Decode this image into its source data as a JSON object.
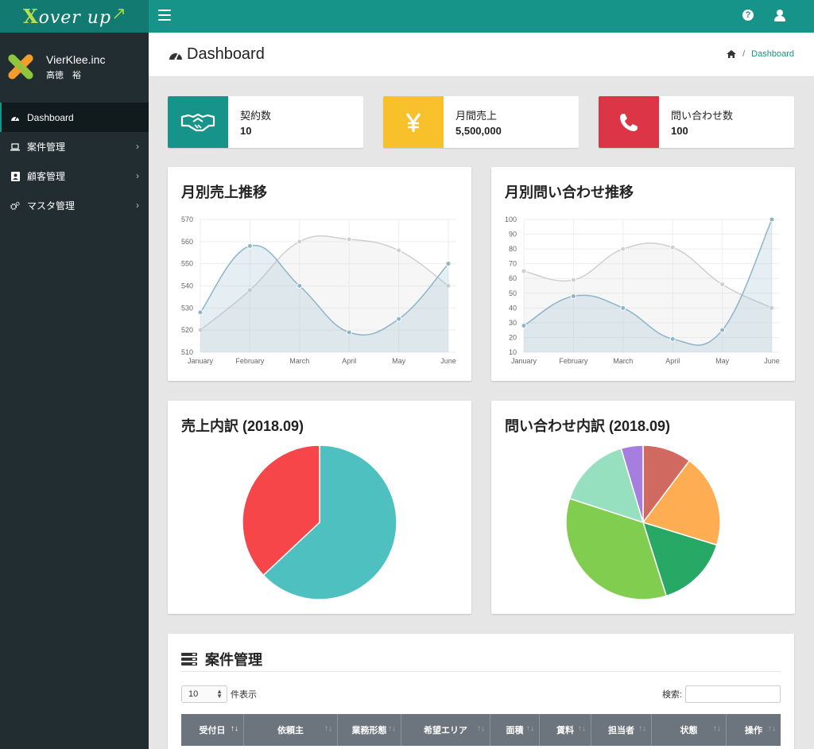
{
  "app": {
    "logo": "over up",
    "logo_x": "X"
  },
  "sidebar": {
    "company": "VierKlee.inc",
    "user": "高徳　裕",
    "items": [
      {
        "label": "Dashboard",
        "icon": "dashboard-icon",
        "active": true
      },
      {
        "label": "案件管理",
        "icon": "laptop-icon"
      },
      {
        "label": "顧客管理",
        "icon": "address-book-icon"
      },
      {
        "label": "マスタ管理",
        "icon": "gears-icon"
      }
    ]
  },
  "header": {
    "title": "Dashboard",
    "breadcrumb": "Dashboard"
  },
  "infoboxes": [
    {
      "label": "契約数",
      "value": "10",
      "color": "#17948a",
      "icon": "handshake-icon"
    },
    {
      "label": "月間売上",
      "value": "5,500,000",
      "color": "#f8c12b",
      "icon": "yen-icon"
    },
    {
      "label": "問い合わせ数",
      "value": "100",
      "color": "#dc3545",
      "icon": "phone-icon"
    }
  ],
  "charts": {
    "sales_trend_title": "月別売上推移",
    "inquiry_trend_title": "月別問い合わせ推移",
    "sales_pie_title": "売上内訳 (2018.09)",
    "inquiry_pie_title": "問い合わせ内訳 (2018.09)"
  },
  "chart_data": [
    {
      "type": "line",
      "title": "月別売上推移",
      "categories": [
        "January",
        "February",
        "March",
        "April",
        "May",
        "June"
      ],
      "ylim": [
        510,
        570
      ],
      "yticks": [
        "570",
        "560",
        "550",
        "540",
        "530",
        "520",
        "510"
      ],
      "series": [
        {
          "values": [
            520,
            538,
            560,
            561,
            556,
            540
          ],
          "color": "#cfcfcf",
          "fill": "rgba(220,220,220,0.25)"
        },
        {
          "values": [
            528,
            558,
            540,
            519,
            525,
            550
          ],
          "color": "#8db4c8",
          "fill": "rgba(151,187,205,0.25)"
        }
      ],
      "grid": true
    },
    {
      "type": "line",
      "title": "月別問い合わせ推移",
      "categories": [
        "January",
        "February",
        "March",
        "April",
        "May",
        "June"
      ],
      "ylim": [
        10,
        100
      ],
      "yticks": [
        "100",
        "90",
        "80",
        "70",
        "60",
        "50",
        "40",
        "30",
        "20",
        "10"
      ],
      "series": [
        {
          "values": [
            65,
            59,
            80,
            81,
            56,
            40
          ],
          "color": "#cfcfcf",
          "fill": "rgba(220,220,220,0.25)"
        },
        {
          "values": [
            28,
            48,
            40,
            19,
            25,
            100
          ],
          "color": "#8db4c8",
          "fill": "rgba(151,187,205,0.25)"
        }
      ],
      "grid": true
    },
    {
      "type": "pie",
      "title": "売上内訳 (2018.09)",
      "values": [
        63,
        37
      ],
      "colors": [
        "#4dc0bf",
        "#f7464a"
      ]
    },
    {
      "type": "pie",
      "title": "問い合わせ内訳 (2018.09)",
      "values": [
        10,
        19,
        15,
        34,
        15,
        4.5
      ],
      "colors": [
        "#d0695f",
        "#ffad52",
        "#28a865",
        "#81cd50",
        "#96e0c0",
        "#a57ee0"
      ]
    }
  ],
  "table": {
    "title": "案件管理",
    "length_value": "10",
    "length_suffix": "件表示",
    "search_label": "検索:",
    "columns": [
      "受付日",
      "依頼主",
      "業務形態",
      "希望エリア",
      "面積",
      "賃料",
      "担当者",
      "状態",
      "操作"
    ]
  }
}
